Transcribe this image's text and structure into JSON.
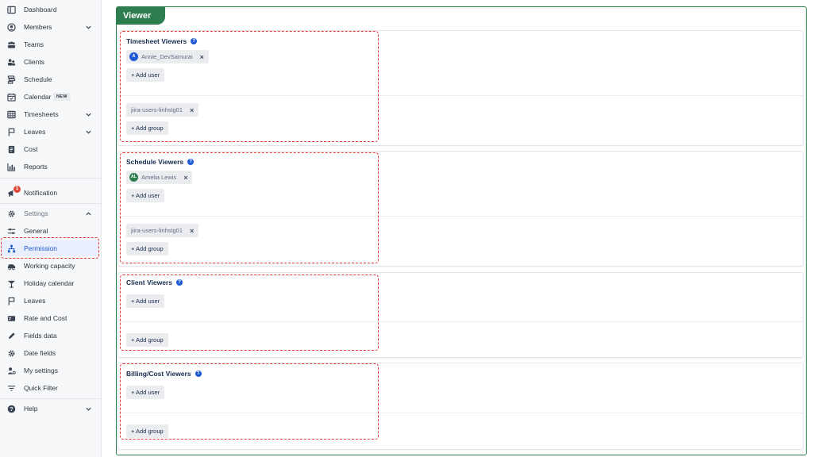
{
  "sidebar": {
    "items": [
      {
        "label": "Dashboard",
        "icon": "dashboard-icon"
      },
      {
        "label": "Members",
        "icon": "members-icon",
        "expandable": true
      },
      {
        "label": "Teams",
        "icon": "teams-icon"
      },
      {
        "label": "Clients",
        "icon": "clients-icon"
      },
      {
        "label": "Schedule",
        "icon": "schedule-icon"
      },
      {
        "label": "Calendar",
        "icon": "calendar-icon",
        "badge": "NEW"
      },
      {
        "label": "Timesheets",
        "icon": "timesheets-icon",
        "expandable": true
      },
      {
        "label": "Leaves",
        "icon": "flag-icon",
        "expandable": true
      },
      {
        "label": "Cost",
        "icon": "cost-icon"
      },
      {
        "label": "Reports",
        "icon": "reports-icon"
      }
    ],
    "notification": {
      "label": "Notification",
      "count": "1"
    },
    "settings": {
      "label": "Settings"
    },
    "settings_items": [
      {
        "label": "General",
        "icon": "sliders-icon"
      },
      {
        "label": "Permission",
        "icon": "hierarchy-icon",
        "active": true
      },
      {
        "label": "Working capacity",
        "icon": "car-icon"
      },
      {
        "label": "Holiday calendar",
        "icon": "holiday-icon"
      },
      {
        "label": "Leaves",
        "icon": "flag-icon"
      },
      {
        "label": "Rate and Cost",
        "icon": "rate-icon"
      },
      {
        "label": "Fields data",
        "icon": "pen-icon"
      },
      {
        "label": "Date fields",
        "icon": "gear-icon"
      },
      {
        "label": "My settings",
        "icon": "user-settings-icon"
      },
      {
        "label": "Quick Filter",
        "icon": "filter-icon"
      }
    ],
    "help": {
      "label": "Help"
    }
  },
  "viewer": {
    "title": "Viewer",
    "sections": [
      {
        "title": "Timesheet Viewers",
        "users": [
          {
            "name": "Annie_DevSamurai",
            "initials": "A",
            "color": "#1f5ad6"
          }
        ],
        "add_user": "+ Add user",
        "groups": [
          "jiira-users-linhstg01"
        ],
        "add_group": "+ Add group"
      },
      {
        "title": "Schedule Viewers",
        "users": [
          {
            "name": "Amelia Lewis",
            "initials": "AL",
            "color": "#2e7d4f"
          }
        ],
        "add_user": "+ Add user",
        "groups": [
          "jiira-users-linhstg01"
        ],
        "add_group": "+ Add group"
      },
      {
        "title": "Client Viewers",
        "users": [],
        "add_user": "+ Add user",
        "groups": [],
        "add_group": "+ Add group"
      },
      {
        "title": "Billing/Cost Viewers",
        "users": [],
        "add_user": "+ Add user",
        "groups": [],
        "add_group": "+ Add group"
      }
    ]
  },
  "colors": {
    "accent": "#1f5ad6",
    "viewer_green": "#2e7d4f",
    "highlight_red": "#e53935"
  }
}
